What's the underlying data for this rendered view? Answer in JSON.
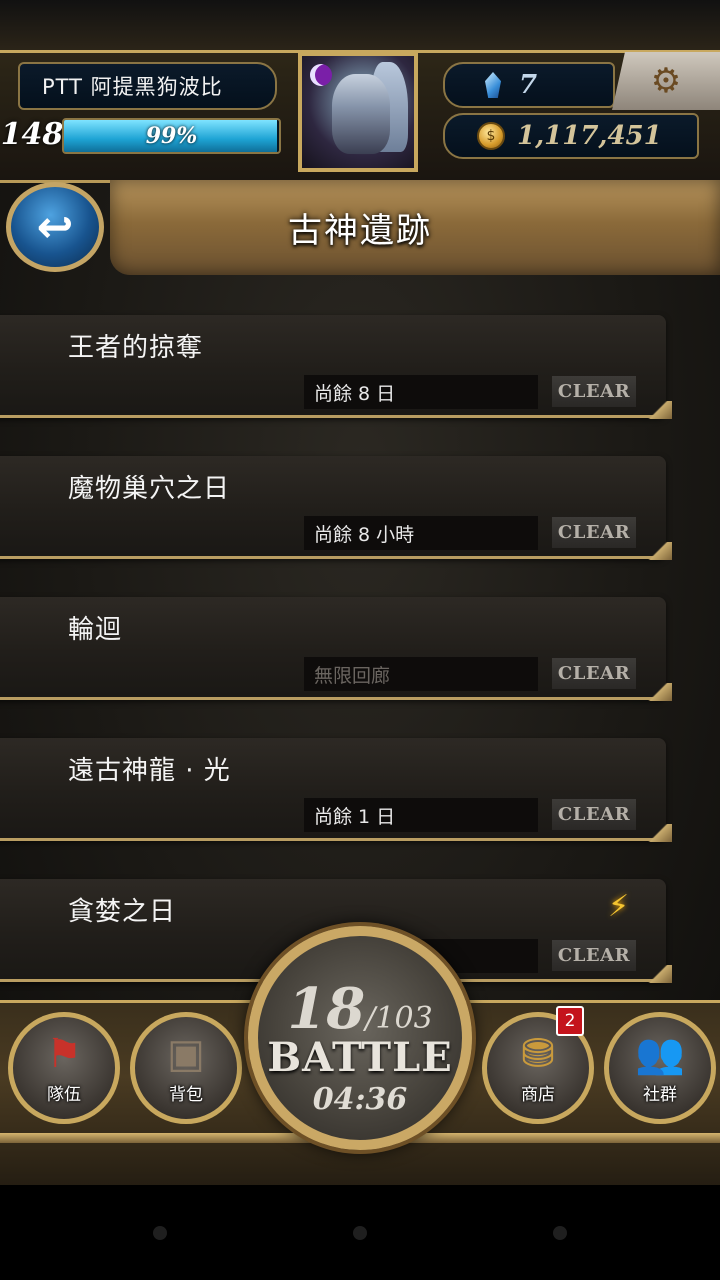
{
  "player": {
    "name": "PTT  阿提黑狗波比",
    "level": "148",
    "exp_percent": "99%",
    "exp_fraction": 0.99
  },
  "currency": {
    "gems": "7",
    "coins": "1,117,451"
  },
  "header": {
    "title": "古神遺跡"
  },
  "stages": [
    {
      "name": "王者的掠奪",
      "status": "尚餘 8 日",
      "badge": "CLEAR",
      "dim": false
    },
    {
      "name": "魔物巢穴之日",
      "status": "尚餘 8 小時",
      "badge": "CLEAR",
      "dim": false
    },
    {
      "name": "輪迴",
      "status": "無限回廊",
      "badge": "CLEAR",
      "dim": true
    },
    {
      "name": "遠古神龍 · 光",
      "status": "尚餘 1 日",
      "badge": "CLEAR",
      "dim": false
    },
    {
      "name": "貪婪之日",
      "status": "",
      "badge": "CLEAR",
      "dim": false
    }
  ],
  "battle": {
    "energy_current": "18",
    "energy_max": "/103",
    "label": "BATTLE",
    "timer": "04:36"
  },
  "nav": {
    "team": "隊伍",
    "bag": "背包",
    "shop": "商店",
    "shop_badge": "2",
    "social": "社群"
  },
  "icons": {
    "back": "back-arrow-icon",
    "gem": "diamond-icon",
    "coin": "coin-icon",
    "settings": "gear-icon",
    "spark": "lightning-icon",
    "team": "flag-icon",
    "bag": "backpack-icon",
    "shop": "treasure-chest-icon",
    "social": "people-icon"
  },
  "colors": {
    "gold_trim": "#c8a85e",
    "exp_bar": "#1ea3d4",
    "badge_red": "#c4141c"
  }
}
